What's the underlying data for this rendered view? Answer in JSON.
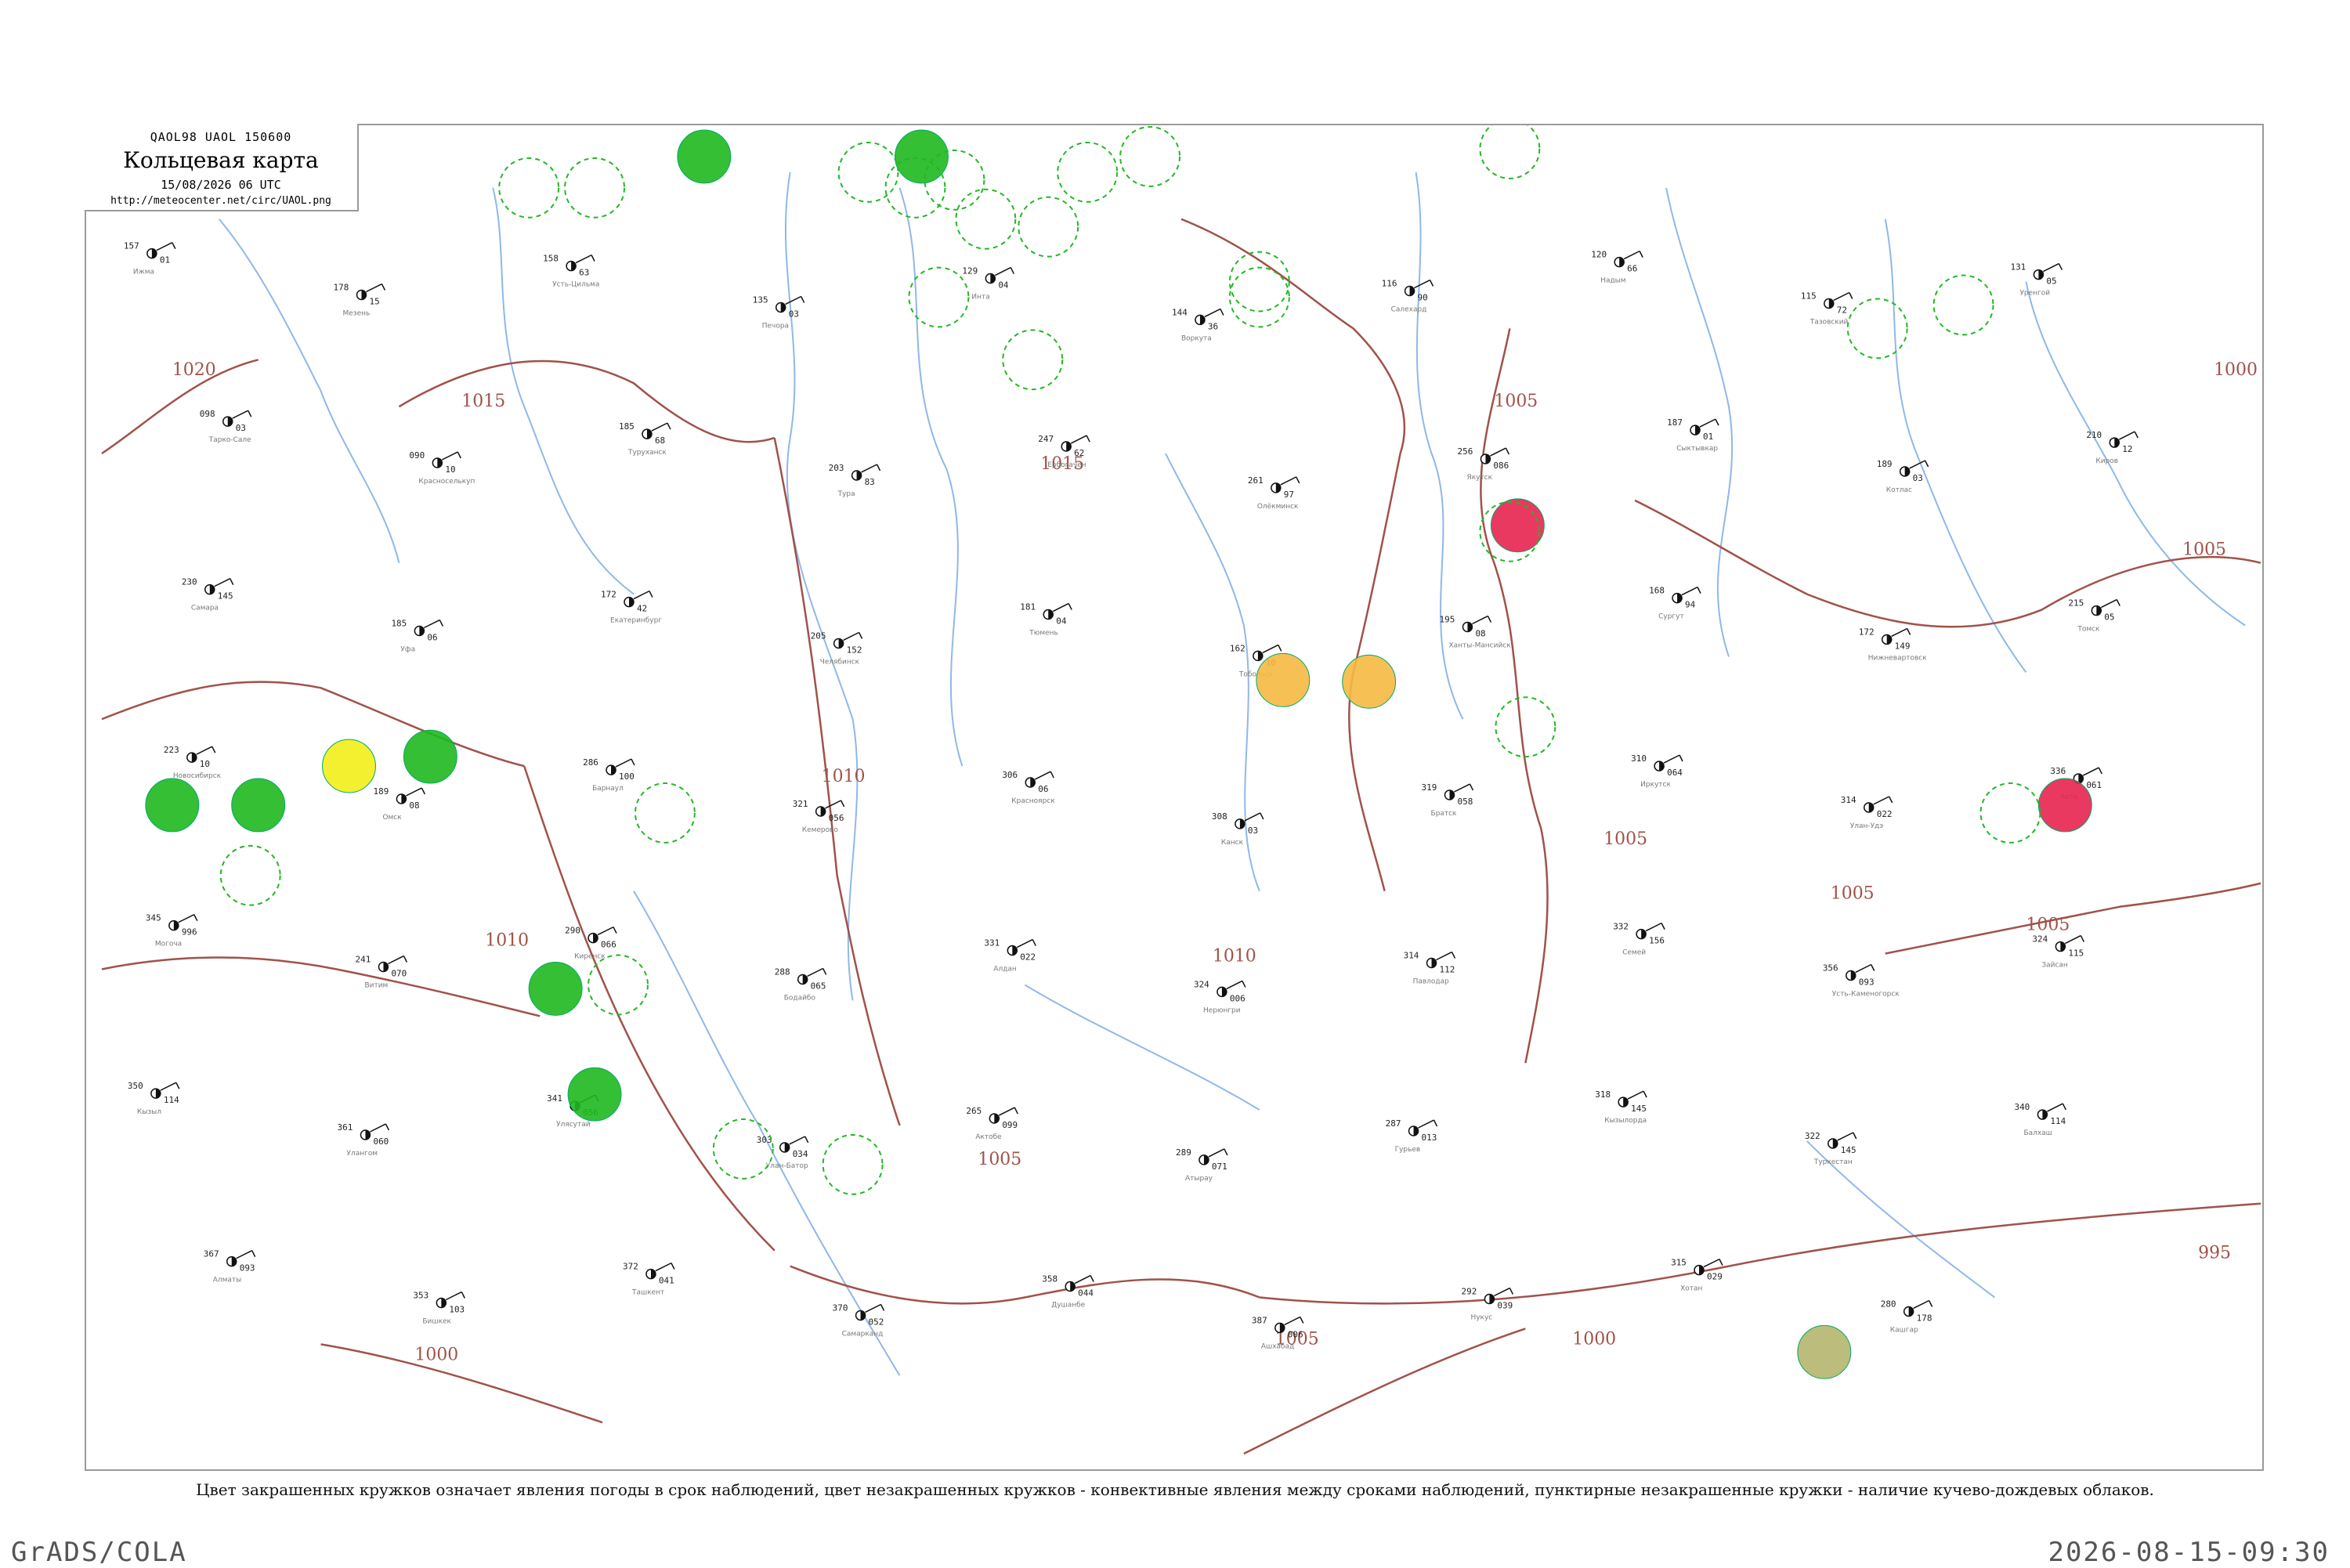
{
  "header": {
    "code_line": "QAOL98  UAOL  150600",
    "title": "Кольцевая карта",
    "datetime": "15/08/2026 06 UTC",
    "url": "http://meteocenter.net/circ/UAOL.png"
  },
  "caption": "Цвет закрашенных кружков означает явления погоды в срок наблюдений, цвет незакрашенных кружков - конвективные явления между сроками наблюдений, пунктирные незакрашенные кружки - наличие кучево-дождевых облаков.",
  "footer": {
    "left": "GrADS/COLA",
    "right": "2026-08-15-09:30"
  },
  "colors": {
    "isobar": "#a0524a",
    "river": "#8fb8e8",
    "weather_rain": "#1fb81f",
    "weather_thunder": "#e8234f",
    "weather_haze": "#f5b942",
    "weather_fog": "#f2ee1a",
    "weather_dust": "#b5b56e",
    "cb_circle": "#22b822"
  },
  "isobar_labels": [
    "1020",
    "1015",
    "1015",
    "1010",
    "1005",
    "1005",
    "1010",
    "1010",
    "1005",
    "1005",
    "1005",
    "1005",
    "1000",
    "1000",
    "1000",
    "1005",
    "995"
  ],
  "stations": [
    {
      "t": "157",
      "p": "01",
      "n": "Ижма"
    },
    {
      "t": "178",
      "p": "15",
      "n": "Мезень"
    },
    {
      "t": "158",
      "p": "63",
      "n": "Усть-Цильма"
    },
    {
      "t": "135",
      "p": "03",
      "n": "Печора"
    },
    {
      "t": "129",
      "p": "04",
      "n": "Инта"
    },
    {
      "t": "144",
      "p": "36",
      "n": "Воркута"
    },
    {
      "t": "116",
      "p": "90",
      "n": "Салехард"
    },
    {
      "t": "120",
      "p": "66",
      "n": "Надым"
    },
    {
      "t": "115",
      "p": "72",
      "n": "Тазовский"
    },
    {
      "t": "131",
      "p": "05",
      "n": "Уренгой"
    },
    {
      "t": "098",
      "p": "03",
      "n": "Тарко-Сале"
    },
    {
      "t": "090",
      "p": "10",
      "n": "Красноселькуп"
    },
    {
      "t": "185",
      "p": "68",
      "n": "Туруханск"
    },
    {
      "t": "203",
      "p": "83",
      "n": "Тура"
    },
    {
      "t": "247",
      "p": "62",
      "n": "Ербогачён"
    },
    {
      "t": "261",
      "p": "97",
      "n": "Олёкминск"
    },
    {
      "t": "256",
      "p": "086",
      "n": "Якутск"
    },
    {
      "t": "187",
      "p": "01",
      "n": "Сыктывкар"
    },
    {
      "t": "189",
      "p": "03",
      "n": "Котлас"
    },
    {
      "t": "210",
      "p": "12",
      "n": "Киров"
    },
    {
      "t": "230",
      "p": "145",
      "n": "Самара"
    },
    {
      "t": "185",
      "p": "06",
      "n": "Уфа"
    },
    {
      "t": "172",
      "p": "42",
      "n": "Екатеринбург"
    },
    {
      "t": "205",
      "p": "152",
      "n": "Челябинск"
    },
    {
      "t": "181",
      "p": "04",
      "n": "Тюмень"
    },
    {
      "t": "162",
      "p": "10",
      "n": "Тобольск"
    },
    {
      "t": "195",
      "p": "08",
      "n": "Ханты-Мансийск"
    },
    {
      "t": "168",
      "p": "94",
      "n": "Сургут"
    },
    {
      "t": "172",
      "p": "149",
      "n": "Нижневартовск"
    },
    {
      "t": "215",
      "p": "05",
      "n": "Томск"
    },
    {
      "t": "223",
      "p": "10",
      "n": "Новосибирск"
    },
    {
      "t": "189",
      "p": "08",
      "n": "Омск"
    },
    {
      "t": "286",
      "p": "100",
      "n": "Барнаул"
    },
    {
      "t": "321",
      "p": "056",
      "n": "Кемерово"
    },
    {
      "t": "306",
      "p": "06",
      "n": "Красноярск"
    },
    {
      "t": "308",
      "p": "03",
      "n": "Канск"
    },
    {
      "t": "319",
      "p": "058",
      "n": "Братск"
    },
    {
      "t": "310",
      "p": "064",
      "n": "Иркутск"
    },
    {
      "t": "314",
      "p": "022",
      "n": "Улан-Удэ"
    },
    {
      "t": "336",
      "p": "061",
      "n": "Чита"
    },
    {
      "t": "345",
      "p": "996",
      "n": "Могоча"
    },
    {
      "t": "241",
      "p": "070",
      "n": "Витим"
    },
    {
      "t": "290",
      "p": "066",
      "n": "Киренск"
    },
    {
      "t": "288",
      "p": "065",
      "n": "Бодайбо"
    },
    {
      "t": "331",
      "p": "022",
      "n": "Алдан"
    },
    {
      "t": "324",
      "p": "006",
      "n": "Нерюнгри"
    },
    {
      "t": "314",
      "p": "112",
      "n": "Павлодар"
    },
    {
      "t": "332",
      "p": "156",
      "n": "Семей"
    },
    {
      "t": "356",
      "p": "093",
      "n": "Усть-Каменогорск"
    },
    {
      "t": "324",
      "p": "115",
      "n": "Зайсан"
    },
    {
      "t": "350",
      "p": "114",
      "n": "Кызыл"
    },
    {
      "t": "361",
      "p": "060",
      "n": "Улангом"
    },
    {
      "t": "341",
      "p": "056",
      "n": "Улясутай"
    },
    {
      "t": "303",
      "p": "034",
      "n": "Улан-Батор"
    },
    {
      "t": "265",
      "p": "099",
      "n": "Актобе"
    },
    {
      "t": "289",
      "p": "071",
      "n": "Атырау"
    },
    {
      "t": "287",
      "p": "013",
      "n": "Гурьев"
    },
    {
      "t": "318",
      "p": "145",
      "n": "Кызылорда"
    },
    {
      "t": "322",
      "p": "145",
      "n": "Туркестан"
    },
    {
      "t": "340",
      "p": "114",
      "n": "Балхаш"
    },
    {
      "t": "367",
      "p": "093",
      "n": "Алматы"
    },
    {
      "t": "353",
      "p": "103",
      "n": "Бишкек"
    },
    {
      "t": "372",
      "p": "041",
      "n": "Ташкент"
    },
    {
      "t": "370",
      "p": "052",
      "n": "Самарканд"
    },
    {
      "t": "358",
      "p": "044",
      "n": "Душанбе"
    },
    {
      "t": "387",
      "p": "006",
      "n": "Ашхабад"
    },
    {
      "t": "292",
      "p": "039",
      "n": "Нукус"
    },
    {
      "t": "315",
      "p": "029",
      "n": "Хотан"
    },
    {
      "t": "280",
      "p": "178",
      "n": "Кашгар"
    }
  ]
}
